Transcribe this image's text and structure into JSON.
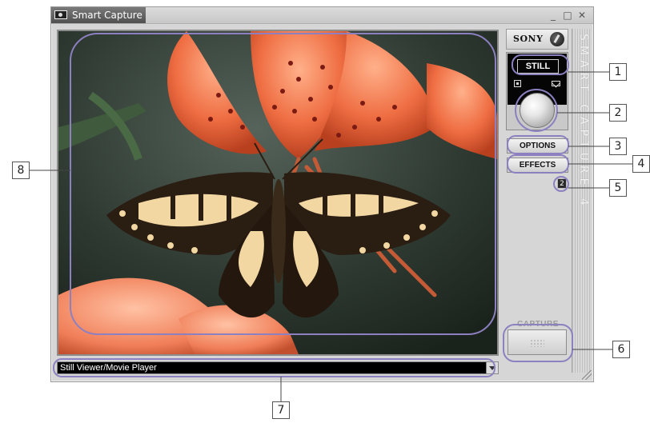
{
  "window": {
    "title": "Smart Capture",
    "controls": {
      "minimize": "_",
      "maximize": "□",
      "close": "✕"
    }
  },
  "brand": {
    "sony": "SONY",
    "vertical": "SMART CAPTURE 4"
  },
  "mode": {
    "label": "STILL",
    "still_icon": "still-camera-icon",
    "movie_icon": "envelope-icon"
  },
  "buttons": {
    "options": "OPTIONS",
    "effects": "EFFECTS",
    "capture_label": "CAPTURE"
  },
  "counter": "2",
  "viewer_select": {
    "value": "Still Viewer/Movie Player"
  },
  "callouts": [
    "1",
    "2",
    "3",
    "4",
    "5",
    "6",
    "7",
    "8"
  ],
  "colors": {
    "annotation": "#8c80c0",
    "window_bg": "#d6d6d6"
  }
}
